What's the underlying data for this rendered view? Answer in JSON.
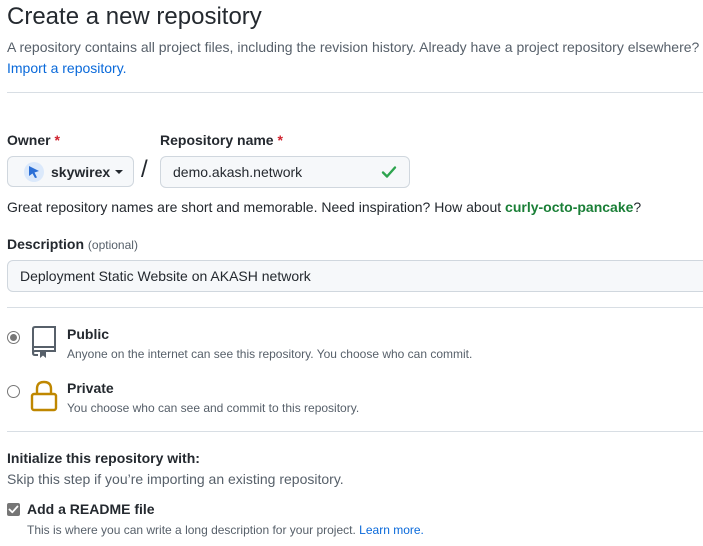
{
  "header": {
    "title": "Create a new repository",
    "subtitle": "A repository contains all project files, including the revision history. Already have a project repository elsewhere?",
    "import_link": "Import a repository."
  },
  "owner": {
    "label": "Owner",
    "required_mark": "*",
    "selected": "skywirex"
  },
  "separator": "/",
  "repo_name": {
    "label": "Repository name",
    "required_mark": "*",
    "value": "demo.akash.network",
    "valid_icon": "check-icon"
  },
  "name_hint": {
    "prefix": "Great repository names are short and memorable. Need inspiration? How about ",
    "suggestion": "curly-octo-pancake",
    "suffix": "?"
  },
  "description": {
    "label": "Description",
    "optional": "(optional)",
    "value": "Deployment Static Website on AKASH network"
  },
  "visibility": {
    "selected": "public",
    "options": [
      {
        "key": "public",
        "title": "Public",
        "description": "Anyone on the internet can see this repository. You choose who can commit.",
        "icon": "repo-icon"
      },
      {
        "key": "private",
        "title": "Private",
        "description": "You choose who can see and commit to this repository.",
        "icon": "lock-icon"
      }
    ]
  },
  "initialize": {
    "title": "Initialize this repository with:",
    "subtitle": "Skip this step if you’re importing an existing repository.",
    "readme": {
      "label": "Add a README file",
      "checked": true,
      "description": "This is where you can write a long description for your project.",
      "learn_more": "Learn more."
    }
  },
  "colors": {
    "accent": "#0969da",
    "success": "#1a7f37",
    "danger": "#cf222e",
    "lock_gold": "#bf8700"
  }
}
